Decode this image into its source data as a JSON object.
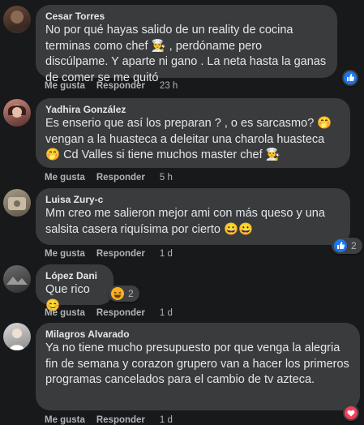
{
  "actions": {
    "like": "Me gusta",
    "reply": "Responder"
  },
  "comments": [
    {
      "author": "Cesar Torres",
      "text": "No por qué hayas salido de un reality de cocina terminas como chef 👨‍🍳 , perdóname pero discúlpame. Y aparte ni gano . La neta hasta la ganas de comer se me quitó",
      "time": "23 h",
      "reaction": {
        "icon": "like-icon",
        "count": ""
      }
    },
    {
      "author": "Yadhira González",
      "text": "Es enserio que así los preparan ? , o es sarcasmo? 🤭 vengan a la huasteca a deleitar una charola huasteca 🤭 Cd Valles si tiene muchos master chef 👨‍🍳",
      "time": "5 h"
    },
    {
      "author": "Luisa Zury-c",
      "text": "Mm creo me salieron mejor ami con más queso y una salsita casera riquísima por cierto 😀😀",
      "time": "1 d",
      "reaction": {
        "icon": "like-icon",
        "count": "2"
      }
    },
    {
      "author": "López Dani",
      "text": "Que rico 😊",
      "time": "1 d",
      "reaction": {
        "icon": "laugh-icon",
        "count": "2"
      }
    },
    {
      "author": "Milagros Alvarado",
      "text": "Ya no tiene mucho presupuesto por que venga la alegria fin de semana y corazon grupero van a hacer los primeros programas cancelados para el cambio de tv azteca.",
      "time": "1 d",
      "reaction": {
        "icon": "love-icon",
        "count": ""
      }
    }
  ],
  "colors": {
    "background": "#18191a",
    "bubble": "#3a3b3c",
    "like_blue": "#1877f2",
    "love_red": "#f33e58"
  }
}
